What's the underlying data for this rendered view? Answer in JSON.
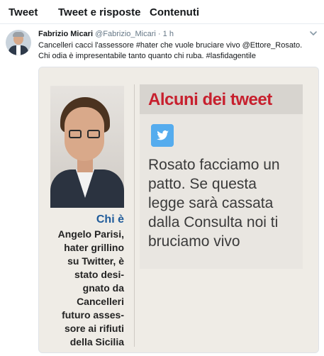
{
  "tabs": [
    {
      "label": "Tweet"
    },
    {
      "label": "Tweet e risposte"
    },
    {
      "label": "Contenuti"
    }
  ],
  "tweet": {
    "author_name": "Fabrizio Micari",
    "handle": "@Fabrizio_Micari",
    "separator": "·",
    "time": "1 h",
    "text_lines": [
      "Cancelleri cacci l'assessore #hater che vuole bruciare vivo @Ettore_Rosato.",
      "Chi odia è impresentabile tanto quanto chi ruba. #lasfidagentile"
    ],
    "icons": {
      "menu": "chevron-down-icon",
      "avatar": "avatar-photo"
    }
  },
  "media": {
    "box_title": "Alcuni dei tweet",
    "box_icon": "twitter-bird-icon",
    "quote_lines": [
      "Rosato facciamo un",
      "patto. Se questa",
      "legge sarà cassata",
      "dalla Consulta noi ti",
      "bruciamo vivo"
    ],
    "side_heading": "Chi è",
    "bio_lines": [
      "Angelo Parisi,",
      "hater grillino",
      "su Twitter, è",
      "stato desi-",
      "gnato da",
      "Cancelleri",
      "futuro asses-",
      "sore ai rifiuti",
      "della Sicilia"
    ]
  },
  "colors": {
    "accent_twitter": "#55acee",
    "headline_red": "#c7202e",
    "chie_blue": "#1f5b9a",
    "text": "#14171a",
    "muted": "#657786"
  }
}
